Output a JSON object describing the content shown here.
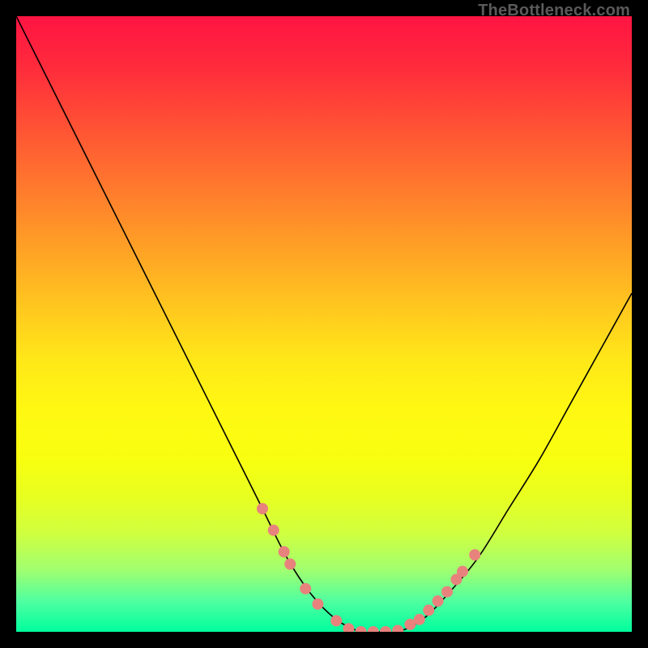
{
  "watermark": "TheBottleneck.com",
  "chart_data": {
    "type": "line",
    "title": "",
    "xlabel": "",
    "ylabel": "",
    "xlim": [
      0,
      100
    ],
    "ylim": [
      0,
      100
    ],
    "series": [
      {
        "name": "curve",
        "color": "#000000",
        "x": [
          0,
          5,
          10,
          15,
          20,
          25,
          30,
          35,
          40,
          44,
          48,
          52,
          56,
          59,
          62,
          66,
          70,
          75,
          80,
          85,
          90,
          95,
          100
        ],
        "y": [
          100,
          90,
          80,
          70,
          60,
          50,
          40,
          30,
          20,
          12,
          6,
          2,
          0,
          0,
          0,
          2,
          6,
          12,
          20,
          28,
          37,
          46,
          55
        ]
      }
    ],
    "markers": {
      "name": "dots",
      "color": "#e8827d",
      "points": [
        {
          "x": 40.0,
          "y": 20.0
        },
        {
          "x": 41.8,
          "y": 16.5
        },
        {
          "x": 43.5,
          "y": 13.0
        },
        {
          "x": 44.5,
          "y": 11.0
        },
        {
          "x": 47.0,
          "y": 7.0
        },
        {
          "x": 49.0,
          "y": 4.5
        },
        {
          "x": 52.0,
          "y": 1.8
        },
        {
          "x": 54.0,
          "y": 0.5
        },
        {
          "x": 56.0,
          "y": 0.0
        },
        {
          "x": 58.0,
          "y": 0.0
        },
        {
          "x": 60.0,
          "y": 0.0
        },
        {
          "x": 62.0,
          "y": 0.2
        },
        {
          "x": 64.0,
          "y": 1.2
        },
        {
          "x": 65.5,
          "y": 2.0
        },
        {
          "x": 67.0,
          "y": 3.5
        },
        {
          "x": 68.5,
          "y": 5.0
        },
        {
          "x": 70.0,
          "y": 6.5
        },
        {
          "x": 71.5,
          "y": 8.5
        },
        {
          "x": 72.5,
          "y": 9.8
        },
        {
          "x": 74.5,
          "y": 12.5
        }
      ]
    },
    "gradient_stops": [
      {
        "pos": 0,
        "color": "#ff1442"
      },
      {
        "pos": 50,
        "color": "#ffd818"
      },
      {
        "pos": 100,
        "color": "#00ff9e"
      }
    ]
  }
}
